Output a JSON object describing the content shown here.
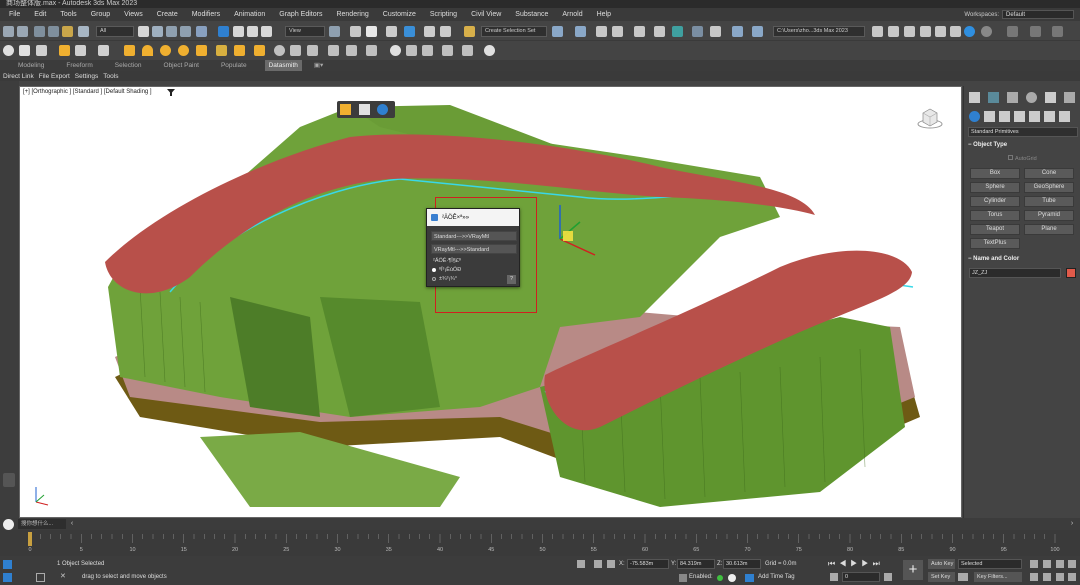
{
  "title_bar": {
    "text": "商场整体版.max - Autodesk 3ds Max 2023"
  },
  "menu": {
    "items": [
      "File",
      "Edit",
      "Tools",
      "Group",
      "Views",
      "Create",
      "Modifiers",
      "Animation",
      "Graph Editors",
      "Rendering",
      "Customize",
      "Scripting",
      "Civil View",
      "Substance",
      "Arnold",
      "Help"
    ],
    "workspaces_label": "Workspaces:",
    "workspaces_value": "Default"
  },
  "toolbar": {
    "selection_filter": "All",
    "reference_coord": "View",
    "named_selection": "Create Selection Set",
    "project_path": "C:\\Users\\zho...3ds Max 2023"
  },
  "ribbon": {
    "tabs": [
      "Modeling",
      "Freeform",
      "Selection",
      "Object Paint",
      "Populate",
      "Datasmith"
    ],
    "active_tab": "Datasmith"
  },
  "datasmith_menu": {
    "items": [
      "Direct Link",
      "File Export",
      "Settings",
      "Tools"
    ]
  },
  "viewport": {
    "label": "[+] [Orthographic ] [Standard ] [Default Shading ]"
  },
  "popup": {
    "title": "²ÄÖÊ×ª»»",
    "row1": "Standard--->>VRayMtl",
    "row2": "VRayMtl--->>Standard",
    "section": "²ÄÖÊ·¶Î§£º",
    "radio1": "ºÏ³¡ËùÓÐ",
    "radio2": "±¾³¡¾°",
    "help_btn": "?"
  },
  "command_panel": {
    "dropdown": "Standard Primitives",
    "object_type_header": "Object Type",
    "autogrid": "AutoGrid",
    "buttons": [
      "Box",
      "Cone",
      "Sphere",
      "GeoSphere",
      "Cylinder",
      "Tube",
      "Torus",
      "Pyramid",
      "Teapot",
      "Plane",
      "TextPlus"
    ],
    "name_color_header": "Name and Color",
    "object_name": "JZ_ZJ",
    "object_color": "#e05a4a"
  },
  "timeline": {
    "frame_label": "0 / 100",
    "ticks": [
      "0",
      "5",
      "10",
      "15",
      "20",
      "25",
      "30",
      "35",
      "40",
      "45",
      "50",
      "55",
      "60",
      "65",
      "70",
      "75",
      "80",
      "85",
      "90",
      "95",
      "100"
    ]
  },
  "status": {
    "objects_selected": "1 Object Selected",
    "prompt": "drag to select and move objects",
    "x_value": "-75.583m",
    "y_value": "84.319m",
    "z_value": "30.613m",
    "grid": "Grid = 0.0m",
    "enabled_label": "Enabled:",
    "add_time_tag": "Add Time Tag",
    "auto_key": "Auto Key",
    "set_key": "Set Key",
    "key_mode": "Selected",
    "key_filters": "Key Filters...",
    "frame": "0",
    "search_placeholder": "搜你想什么..."
  }
}
